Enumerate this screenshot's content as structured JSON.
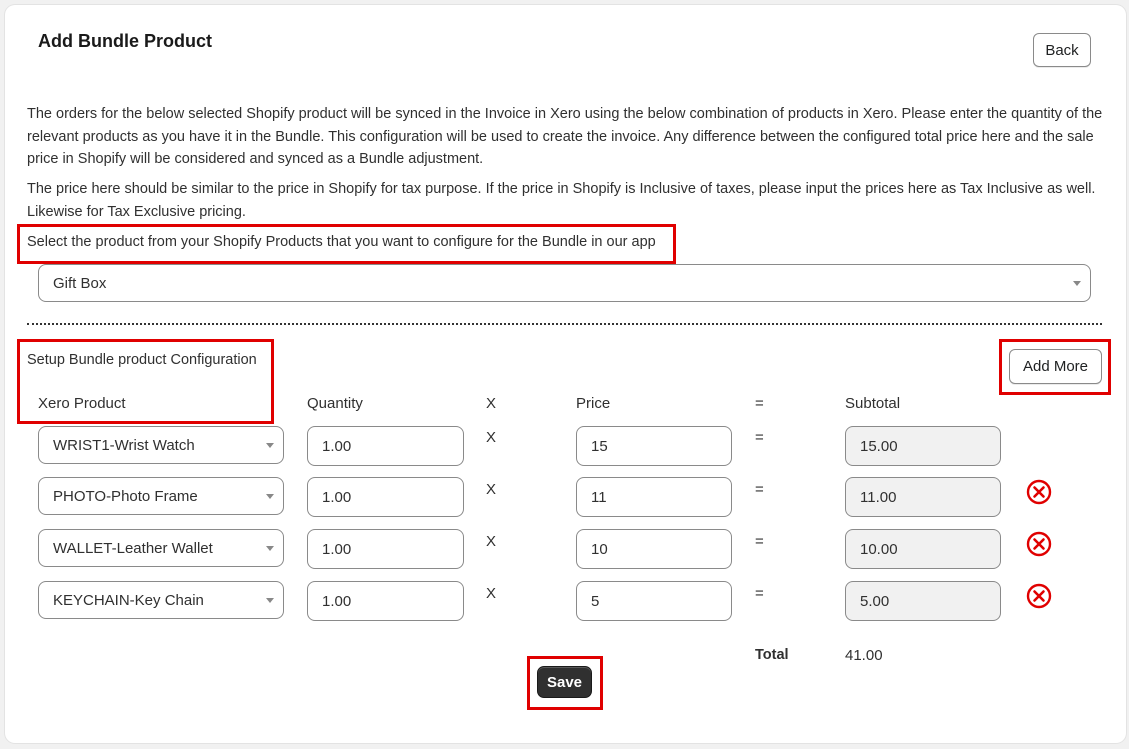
{
  "header": {
    "title": "Add Bundle Product",
    "back_label": "Back"
  },
  "description": {
    "paragraph1": "The orders for the below selected Shopify product will be synced in the Invoice in Xero using the below combination of products in Xero. Please enter the quantity of the relevant products as you have it in the Bundle. This configuration will be used to create the invoice. Any difference between the configured total price here and the sale price in Shopify will be considered and synced as a Bundle adjustment.",
    "paragraph2": "The price here should be similar to the price in Shopify for tax purpose. If the price in Shopify is Inclusive of taxes, please input the prices here as Tax Inclusive as well. Likewise for Tax Exclusive pricing."
  },
  "shopify_select": {
    "label": "Select the product from your Shopify Products that you want to configure for the Bundle in our app",
    "value": "Gift Box"
  },
  "config": {
    "section_label": "Setup Bundle product Configuration",
    "add_more_label": "Add More",
    "headers": {
      "product": "Xero Product",
      "quantity": "Quantity",
      "times": "X",
      "price": "Price",
      "equals": "=",
      "subtotal": "Subtotal"
    },
    "rows": [
      {
        "product": "WRIST1-Wrist Watch",
        "quantity": "1.00",
        "op_times": "X",
        "price": "15",
        "op_equals": "=",
        "subtotal": "15.00",
        "removable": false
      },
      {
        "product": "PHOTO-Photo Frame",
        "quantity": "1.00",
        "op_times": "X",
        "price": "11",
        "op_equals": "=",
        "subtotal": "11.00",
        "removable": true
      },
      {
        "product": "WALLET-Leather Wallet",
        "quantity": "1.00",
        "op_times": "X",
        "price": "10",
        "op_equals": "=",
        "subtotal": "10.00",
        "removable": true
      },
      {
        "product": "KEYCHAIN-Key Chain",
        "quantity": "1.00",
        "op_times": "X",
        "price": "5",
        "op_equals": "=",
        "subtotal": "5.00",
        "removable": true
      }
    ],
    "total_label": "Total",
    "total_value": "41.00"
  },
  "save_label": "Save",
  "icons": {
    "remove": "remove-circle-x-icon",
    "dropdown": "chevron-down-icon"
  },
  "colors": {
    "highlight": "#e00000",
    "remove": "#e00000",
    "primary_button": "#303030"
  }
}
